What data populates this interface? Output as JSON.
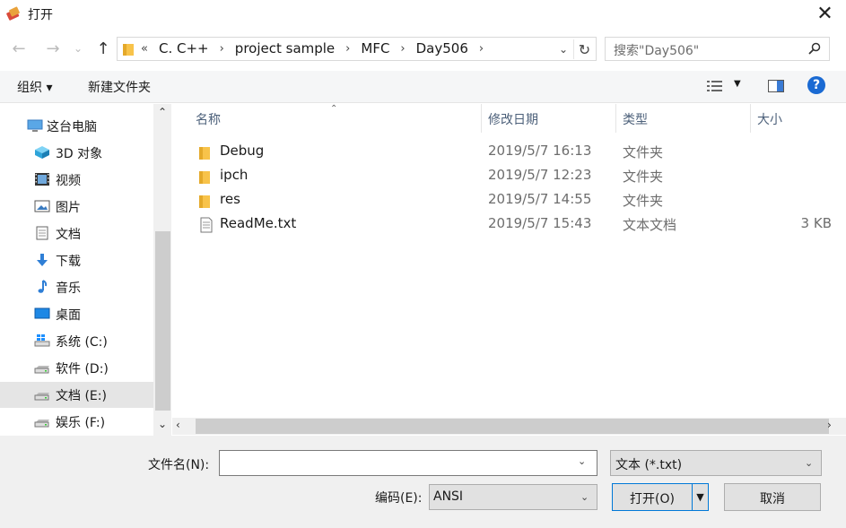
{
  "window": {
    "title": "打开",
    "close_glyph": "✕"
  },
  "nav": {
    "back": "←",
    "forward": "→",
    "recent": "⌄",
    "up": "↑"
  },
  "address": {
    "prefix": "«",
    "crumbs": [
      "C. C++",
      "project sample",
      "MFC",
      "Day506"
    ],
    "dropdown_glyph": "⌄",
    "refresh_glyph": "↻"
  },
  "search": {
    "placeholder": "搜索\"Day506\""
  },
  "toolbar": {
    "organize": "组织 ▾",
    "new_folder": "新建文件夹",
    "view_dd": "▼",
    "help": "?"
  },
  "sidebar": {
    "items": [
      {
        "label": "这台电脑",
        "icon": "computer-icon"
      },
      {
        "label": "3D 对象",
        "icon": "cube-icon"
      },
      {
        "label": "视频",
        "icon": "video-icon"
      },
      {
        "label": "图片",
        "icon": "picture-icon"
      },
      {
        "label": "文档",
        "icon": "document-icon"
      },
      {
        "label": "下载",
        "icon": "download-icon"
      },
      {
        "label": "音乐",
        "icon": "music-icon"
      },
      {
        "label": "桌面",
        "icon": "desktop-icon"
      },
      {
        "label": "系统 (C:)",
        "icon": "windows-drive-icon"
      },
      {
        "label": "软件 (D:)",
        "icon": "drive-icon"
      },
      {
        "label": "文档 (E:)",
        "icon": "drive-icon"
      },
      {
        "label": "娱乐 (F:)",
        "icon": "drive-icon"
      }
    ],
    "selected_index": 10,
    "scroll_up": "⌃",
    "scroll_down": "⌄"
  },
  "columns": {
    "name": "名称",
    "modified": "修改日期",
    "type": "类型",
    "size": "大小",
    "sort_glyph": "⌃"
  },
  "files": [
    {
      "name": "Debug",
      "modified": "2019/5/7 16:13",
      "type": "文件夹",
      "size": "",
      "icon": "folder-icon"
    },
    {
      "name": "ipch",
      "modified": "2019/5/7 12:23",
      "type": "文件夹",
      "size": "",
      "icon": "folder-icon"
    },
    {
      "name": "res",
      "modified": "2019/5/7 14:55",
      "type": "文件夹",
      "size": "",
      "icon": "folder-icon"
    },
    {
      "name": "ReadMe.txt",
      "modified": "2019/5/7 15:43",
      "type": "文本文档",
      "size": "3 KB",
      "icon": "text-file-icon"
    }
  ],
  "hscroll": {
    "left": "‹",
    "right": "›"
  },
  "footer": {
    "filename_label": "文件名(N):",
    "filename_value": "",
    "filter_value": "文本 (*.txt)",
    "encoding_label": "编码(E):",
    "encoding_value": "ANSI",
    "open_label": "打开(O)",
    "cancel_label": "取消",
    "dd_glyph": "⌄",
    "split_glyph": "▼"
  },
  "colors": {
    "accent": "#0078d7",
    "folder": "#f8c34a",
    "help": "#1a6ad3"
  }
}
